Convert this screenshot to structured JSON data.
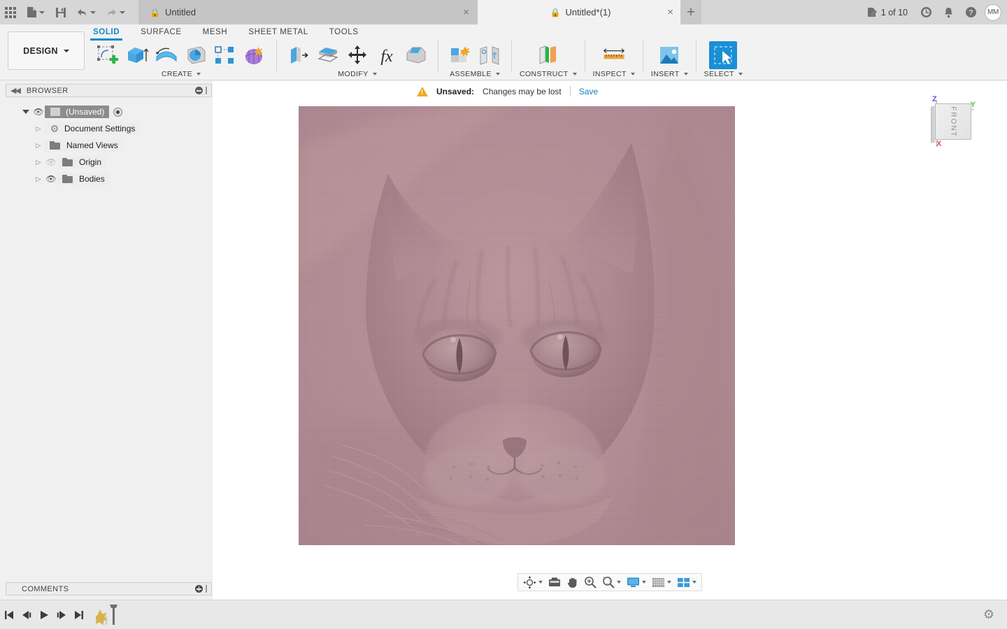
{
  "app": {
    "name": "Fusion 360",
    "accent": "#1a8fd4",
    "link_color": "#0f7ec0"
  },
  "topbar": {
    "icons": [
      {
        "name": "app-grid-icon",
        "glyph": "grid"
      },
      {
        "name": "new-document-icon",
        "glyph": "file"
      },
      {
        "name": "save-icon",
        "glyph": "floppy"
      },
      {
        "name": "undo-icon",
        "glyph": "undo"
      },
      {
        "name": "redo-icon",
        "glyph": "redo"
      }
    ],
    "tabs": [
      {
        "label": "Untitled",
        "active": false,
        "locked": true,
        "close": "×"
      },
      {
        "label": "Untitled*(1)",
        "active": true,
        "locked": true,
        "close": "×"
      }
    ],
    "new_tab_label": "+",
    "counter": "1 of 10",
    "right_icons": [
      {
        "name": "job-status-icon"
      },
      {
        "name": "recent-activity-icon"
      },
      {
        "name": "notifications-bell-icon"
      },
      {
        "name": "help-icon"
      }
    ],
    "avatar_initials": "MM"
  },
  "ribbon": {
    "workspace_label": "DESIGN",
    "tabs": [
      {
        "label": "SOLID",
        "active": true
      },
      {
        "label": "SURFACE",
        "active": false
      },
      {
        "label": "MESH",
        "active": false
      },
      {
        "label": "SHEET METAL",
        "active": false
      },
      {
        "label": "TOOLS",
        "active": false
      }
    ],
    "groups": [
      {
        "label": "CREATE",
        "dropdown": true,
        "tools": [
          {
            "name": "create-sketch-tool"
          },
          {
            "name": "extrude-tool"
          },
          {
            "name": "revolve-tool"
          },
          {
            "name": "sweep-tool"
          },
          {
            "name": "pattern-tool"
          },
          {
            "name": "form-tool"
          }
        ]
      },
      {
        "label": "MODIFY",
        "dropdown": true,
        "tools": [
          {
            "name": "press-pull-tool"
          },
          {
            "name": "offset-face-tool"
          },
          {
            "name": "move-copy-tool"
          },
          {
            "name": "change-parameters-tool"
          },
          {
            "name": "chamfer-tool"
          }
        ]
      },
      {
        "label": "ASSEMBLE",
        "dropdown": true,
        "tools": [
          {
            "name": "new-component-tool"
          },
          {
            "name": "joint-tool"
          }
        ]
      },
      {
        "label": "CONSTRUCT",
        "dropdown": true,
        "tools": [
          {
            "name": "construct-plane-tool"
          }
        ]
      },
      {
        "label": "INSPECT",
        "dropdown": true,
        "tools": [
          {
            "name": "measure-tool"
          }
        ]
      },
      {
        "label": "INSERT",
        "dropdown": true,
        "tools": [
          {
            "name": "insert-image-tool"
          }
        ]
      },
      {
        "label": "SELECT",
        "dropdown": true,
        "selected": true,
        "tools": [
          {
            "name": "select-window-tool"
          }
        ]
      }
    ]
  },
  "browser": {
    "title": "BROWSER",
    "collapse_glyph": "◀◀",
    "tree": [
      {
        "label": "(Unsaved)",
        "indent": 0,
        "expanded": true,
        "eye": "visible",
        "icon": "document-cube-icon",
        "selected": true,
        "has_activate_dot": true
      },
      {
        "label": "Document Settings",
        "indent": 1,
        "expanded": false,
        "eye": "none",
        "icon": "gear-icon"
      },
      {
        "label": "Named Views",
        "indent": 1,
        "expanded": false,
        "eye": "none",
        "icon": "folder-icon"
      },
      {
        "label": "Origin",
        "indent": 1,
        "expanded": false,
        "eye": "hidden",
        "icon": "folder-icon"
      },
      {
        "label": "Bodies",
        "indent": 1,
        "expanded": false,
        "eye": "visible",
        "icon": "folder-icon"
      }
    ]
  },
  "notification": {
    "warning_label": "Unsaved:",
    "message": "Changes may be lost",
    "action_label": "Save"
  },
  "canvas": {
    "image_name": "inserted-canvas-cat-photo",
    "description": "Tabby cat face photograph inserted as canvas, tinted mauve",
    "tint_base": "#b0899 2",
    "colors": {
      "base": "#b08a92",
      "shadow": "#96737c",
      "highlight": "#c2a0a6",
      "background": "#ffffff"
    }
  },
  "viewcube": {
    "face_label": "FRONT",
    "axes": [
      {
        "label": "Z",
        "color": "#5b5be0"
      },
      {
        "label": "Y",
        "color": "#3cc94c"
      },
      {
        "label": "X",
        "color": "#e8504b"
      }
    ]
  },
  "navbar": {
    "tools": [
      {
        "name": "orbit-tool",
        "dropdown": true
      },
      {
        "name": "look-at-tool",
        "dropdown": false
      },
      {
        "name": "pan-tool",
        "dropdown": false
      },
      {
        "name": "zoom-tool",
        "dropdown": false
      },
      {
        "name": "fit-tool",
        "dropdown": true
      },
      {
        "name": "display-settings-tool",
        "dropdown": true
      },
      {
        "name": "grid-snap-tool",
        "dropdown": true
      },
      {
        "name": "viewport-layout-tool",
        "dropdown": true
      }
    ]
  },
  "comments": {
    "title": "COMMENTS",
    "add_glyph": "+"
  },
  "timeline": {
    "controls": [
      {
        "name": "go-to-beginning-button"
      },
      {
        "name": "step-back-button"
      },
      {
        "name": "play-button"
      },
      {
        "name": "step-forward-button"
      },
      {
        "name": "go-to-end-button"
      }
    ],
    "marker_name": "timeline-end-marker",
    "settings_name": "settings-gear-icon"
  }
}
